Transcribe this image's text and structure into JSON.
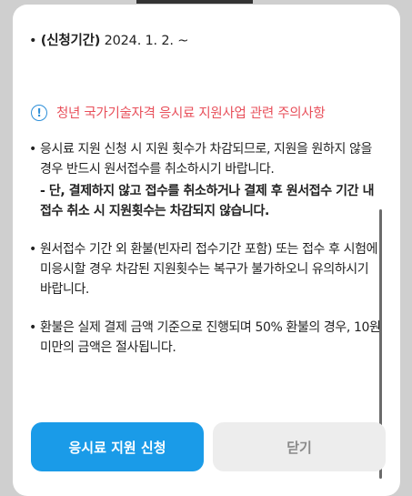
{
  "period": {
    "label": "(신청기간)",
    "value": "2024. 1. 2. ~"
  },
  "warning": {
    "icon": "info-icon",
    "title": "청년 국가기술자격 응시료 지원사업 관련 주의사항"
  },
  "notes": [
    {
      "text": "응시료 지원 신청 시 지원 횟수가 차감되므로, 지원을 원하지 않을 경우 반드시 원서접수를 취소하시기 바랍니다.",
      "emphasis": "- 단, 결제하지 않고 접수를 취소하거나 결제 후 원서접수 기간 내 접수 취소 시 지원횟수는 차감되지 않습니다."
    },
    {
      "text": "원서접수 기간 외 환불(빈자리 접수기간 포함) 또는 접수 후 시험에 미응시할 경우 차감된 지원횟수는 복구가 불가하오니 유의하시기 바랍니다."
    },
    {
      "text": "환불은 실제 결제 금액 기준으로 진행되며 50% 환불의 경우, 10원 미만의 금액은 절사됩니다."
    }
  ],
  "buttons": {
    "apply": "응시료 지원 신청",
    "close": "닫기"
  },
  "colors": {
    "accent": "#1a9be8",
    "warning": "#e8505b",
    "info_icon": "#2d8fd8"
  }
}
